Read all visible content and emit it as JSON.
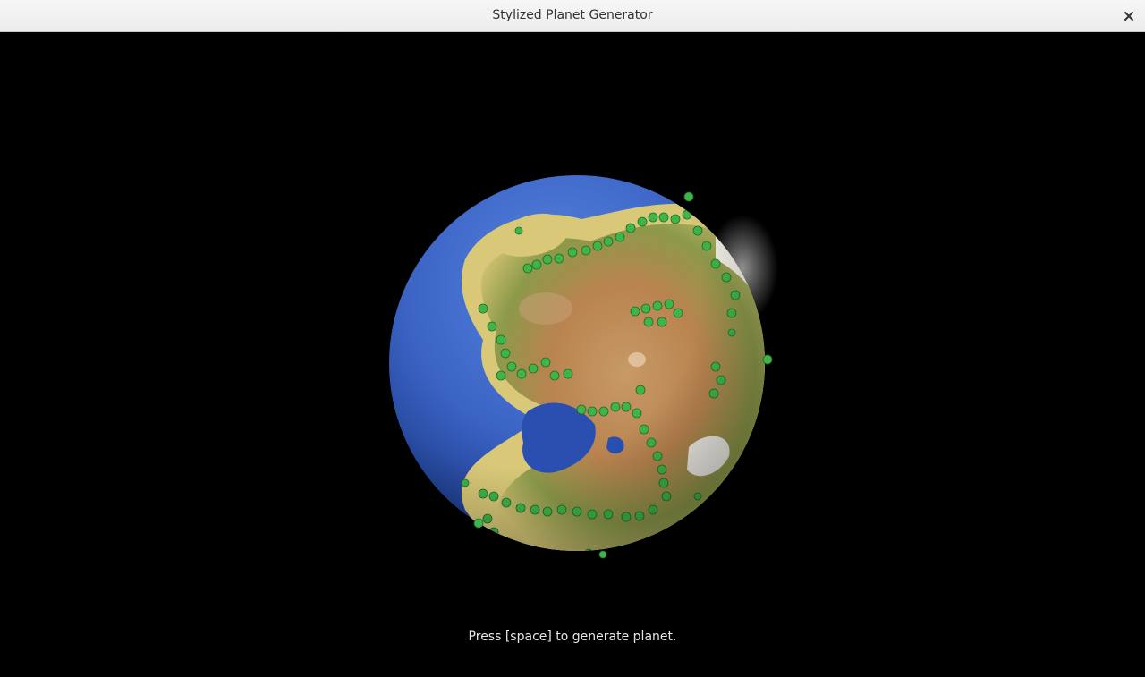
{
  "window": {
    "title": "Stylized Planet Generator",
    "close_icon": "close-icon"
  },
  "scene": {
    "hint_text": "Press [space] to generate planet.",
    "colors": {
      "background": "#000000",
      "ocean": "#3a63c4",
      "ocean_shadow": "#1b3a8a",
      "sand": "#d8c878",
      "grass": "#8a9a4a",
      "desert": "#b88a55",
      "snow": "#f2efe8",
      "trees": "#3fb548"
    }
  }
}
